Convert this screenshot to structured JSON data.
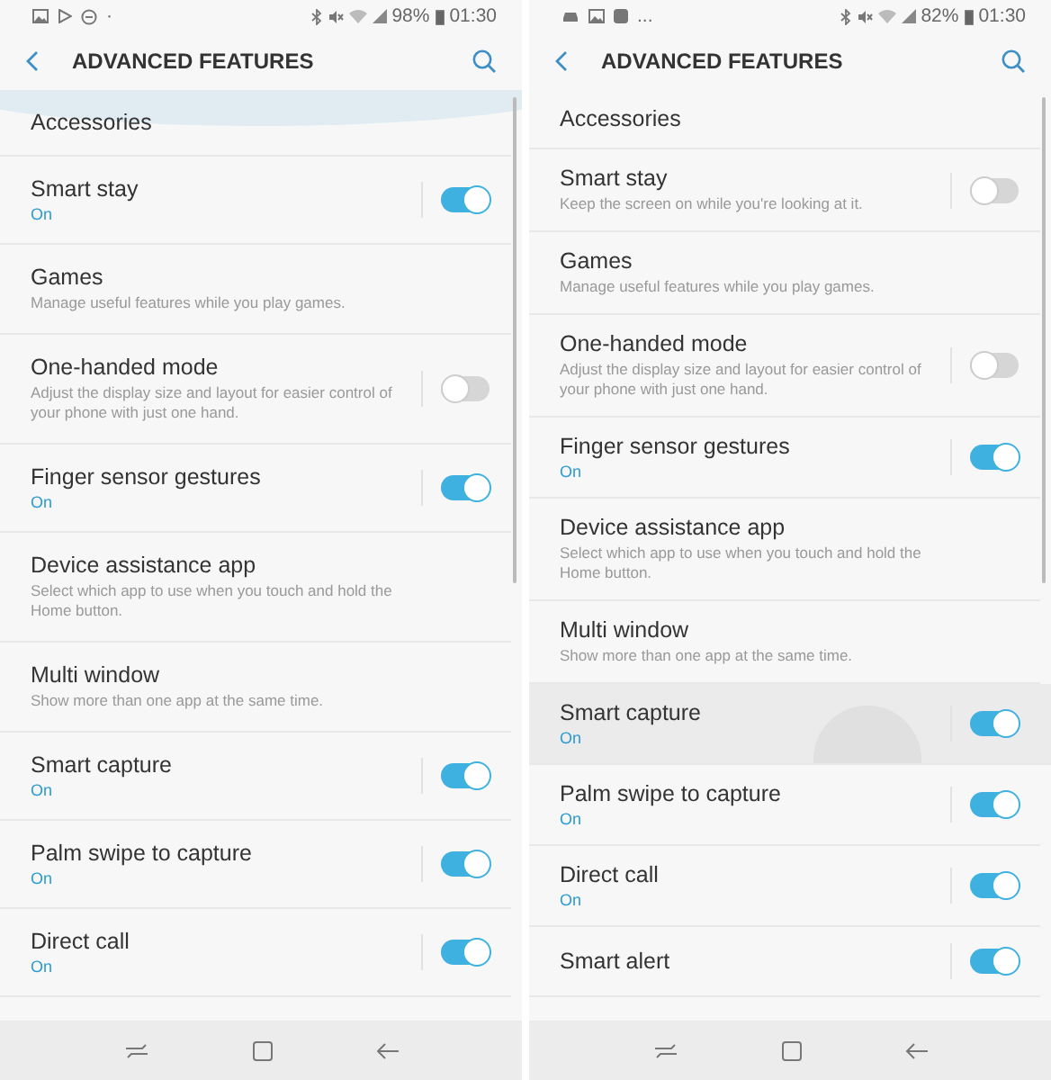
{
  "screens": [
    {
      "status_bar": {
        "notifications": [
          {
            "kind": "picture"
          },
          {
            "kind": "play"
          },
          {
            "kind": "minus"
          }
        ],
        "more": "·",
        "battery": "98%",
        "time": "01:30"
      },
      "header": {
        "title": "ADVANCED FEATURES"
      },
      "overscroll": true,
      "items": [
        {
          "kind": "plain",
          "title": "Accessories",
          "selected": false
        },
        {
          "kind": "toggle",
          "title": "Smart stay",
          "status": "On",
          "on": true,
          "selected": false
        },
        {
          "kind": "plain",
          "title": "Games",
          "description": "Manage useful features while you play games.",
          "selected": false
        },
        {
          "kind": "toggle",
          "title": "One-handed mode",
          "description": "Adjust the display size and layout for easier control of your phone with just one hand.",
          "on": false,
          "selected": false
        },
        {
          "kind": "toggle",
          "title": "Finger sensor gestures",
          "status": "On",
          "on": true,
          "selected": false
        },
        {
          "kind": "plain",
          "title": "Device assistance app",
          "description": "Select which app to use when you touch and hold the Home button.",
          "selected": false
        },
        {
          "kind": "plain",
          "title": "Multi window",
          "description": "Show more than one app at the same time.",
          "selected": false
        },
        {
          "kind": "toggle",
          "title": "Smart capture",
          "status": "On",
          "on": true,
          "selected": false
        },
        {
          "kind": "toggle",
          "title": "Palm swipe to capture",
          "status": "On",
          "on": true,
          "selected": false
        },
        {
          "kind": "toggle",
          "title": "Direct call",
          "status": "On",
          "on": true,
          "selected": false
        }
      ]
    },
    {
      "status_bar": {
        "notifications": [
          {
            "kind": "car"
          },
          {
            "kind": "picture"
          },
          {
            "kind": "square"
          }
        ],
        "more": "...",
        "battery": "82%",
        "time": "01:30"
      },
      "header": {
        "title": "ADVANCED FEATURES"
      },
      "overscroll": false,
      "items": [
        {
          "kind": "plain",
          "title": "Accessories",
          "selected": false
        },
        {
          "kind": "toggle",
          "title": "Smart stay",
          "description": "Keep the screen on while you're looking at it.",
          "on": false,
          "selected": false
        },
        {
          "kind": "plain",
          "title": "Games",
          "description": "Manage useful features while you play games.",
          "selected": false
        },
        {
          "kind": "toggle",
          "title": "One-handed mode",
          "description": "Adjust the display size and layout for easier control of your phone with just one hand.",
          "on": false,
          "selected": false
        },
        {
          "kind": "toggle",
          "title": "Finger sensor gestures",
          "status": "On",
          "on": true,
          "selected": false
        },
        {
          "kind": "plain",
          "title": "Device assistance app",
          "description": "Select which app to use when you touch and hold the Home button.",
          "selected": false
        },
        {
          "kind": "plain",
          "title": "Multi window",
          "description": "Show more than one app at the same time.",
          "selected": false
        },
        {
          "kind": "toggle",
          "title": "Smart capture",
          "status": "On",
          "on": true,
          "selected": true
        },
        {
          "kind": "toggle",
          "title": "Palm swipe to capture",
          "status": "On",
          "on": true,
          "selected": false
        },
        {
          "kind": "toggle",
          "title": "Direct call",
          "status": "On",
          "on": true,
          "selected": false
        },
        {
          "kind": "toggle",
          "title": "Smart alert",
          "on": true,
          "selected": false
        }
      ]
    }
  ]
}
